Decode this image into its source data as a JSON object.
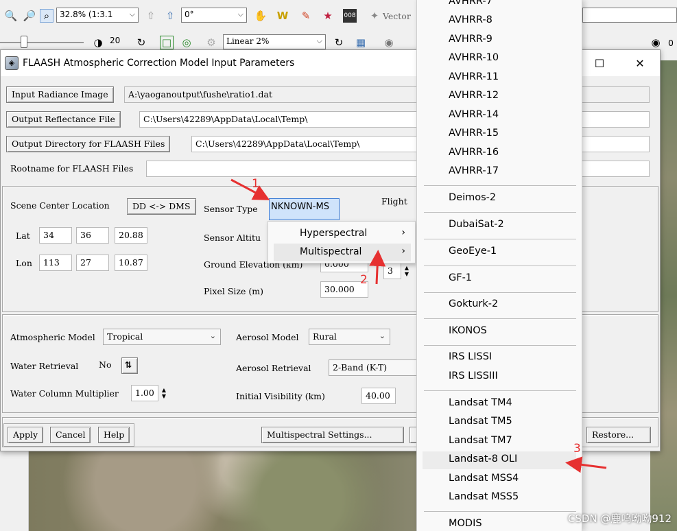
{
  "toolbar": {
    "zoom_value": "32.8% (1:3.1",
    "rotation_value": "0°",
    "vector_label": "Vector",
    "brightness_value": "20",
    "stretch_value": "Linear 2%",
    "right_value": "0"
  },
  "dialog": {
    "title": "FLAASH Atmospheric Correction Model Input Parameters",
    "input_radiance_button": "Input Radiance Image",
    "input_radiance_path": "A:\\yaoganoutput\\fushe\\ratio1.dat",
    "output_reflectance_button": "Output Reflectance File",
    "output_reflectance_path": "C:\\Users\\42289\\AppData\\Local\\Temp\\",
    "output_directory_button": "Output Directory for FLAASH Files",
    "output_directory_path": "C:\\Users\\42289\\AppData\\Local\\Temp\\",
    "rootname_label": "Rootname for FLAASH Files",
    "rootname_value": "",
    "scene": {
      "scene_center_label": "Scene Center Location",
      "dd_dms_button": "DD <-> DMS",
      "lat_label": "Lat",
      "lat_deg": "34",
      "lat_min": "36",
      "lat_sec": "20.88",
      "lon_label": "Lon",
      "lon_deg": "113",
      "lon_min": "27",
      "lon_sec": "10.87"
    },
    "sensor": {
      "sensor_type_label": "Sensor Type",
      "sensor_type_value": "NKNOWN-MS",
      "sensor_altitude_label": "Sensor Altitu",
      "ground_elevation_label": "Ground Elevation (km)",
      "ground_elevation_value": "0.000",
      "pixel_size_label": "Pixel Size (m)",
      "pixel_size_value": "30.000",
      "flight_label": "Flight",
      "spin_value": "3"
    },
    "atmosphere": {
      "atm_model_label": "Atmospheric Model",
      "atm_model_value": "Tropical",
      "aerosol_model_label": "Aerosol Model",
      "aerosol_model_value": "Rural",
      "water_retrieval_label": "Water Retrieval",
      "water_retrieval_value": "No",
      "aerosol_retrieval_label": "Aerosol Retrieval",
      "aerosol_retrieval_value": "2-Band (K-T)",
      "water_column_label": "Water Column Multiplier",
      "water_column_value": "1.00",
      "initial_visibility_label": "Initial Visibility (km)",
      "initial_visibility_value": "40.00"
    },
    "footer": {
      "apply": "Apply",
      "cancel": "Cancel",
      "help": "Help",
      "multispectral_settings": "Multispectral Settings...",
      "restore": "Restore..."
    }
  },
  "submenu": {
    "items": [
      "Hyperspectral",
      "Multispectral"
    ]
  },
  "sensor_list": {
    "items": [
      "AVHRR-7",
      "AVHRR-8",
      "AVHRR-9",
      "AVHRR-10",
      "AVHRR-11",
      "AVHRR-12",
      "AVHRR-14",
      "AVHRR-15",
      "AVHRR-16",
      "AVHRR-17",
      "Deimos-2",
      "DubaiSat-2",
      "GeoEye-1",
      "GF-1",
      "Gokturk-2",
      "IKONOS",
      "IRS LISSI",
      "IRS LISSIII",
      "Landsat TM4",
      "Landsat TM5",
      "Landsat TM7",
      "Landsat-8 OLI",
      "Landsat MSS4",
      "Landsat MSS5",
      "MODIS"
    ],
    "selected": "Landsat-8 OLI"
  },
  "annotations": {
    "step1": "1",
    "step2": "2",
    "step3": "3",
    "color": "#e63030"
  },
  "watermark": "CSDN @鹿呜呦呦912"
}
